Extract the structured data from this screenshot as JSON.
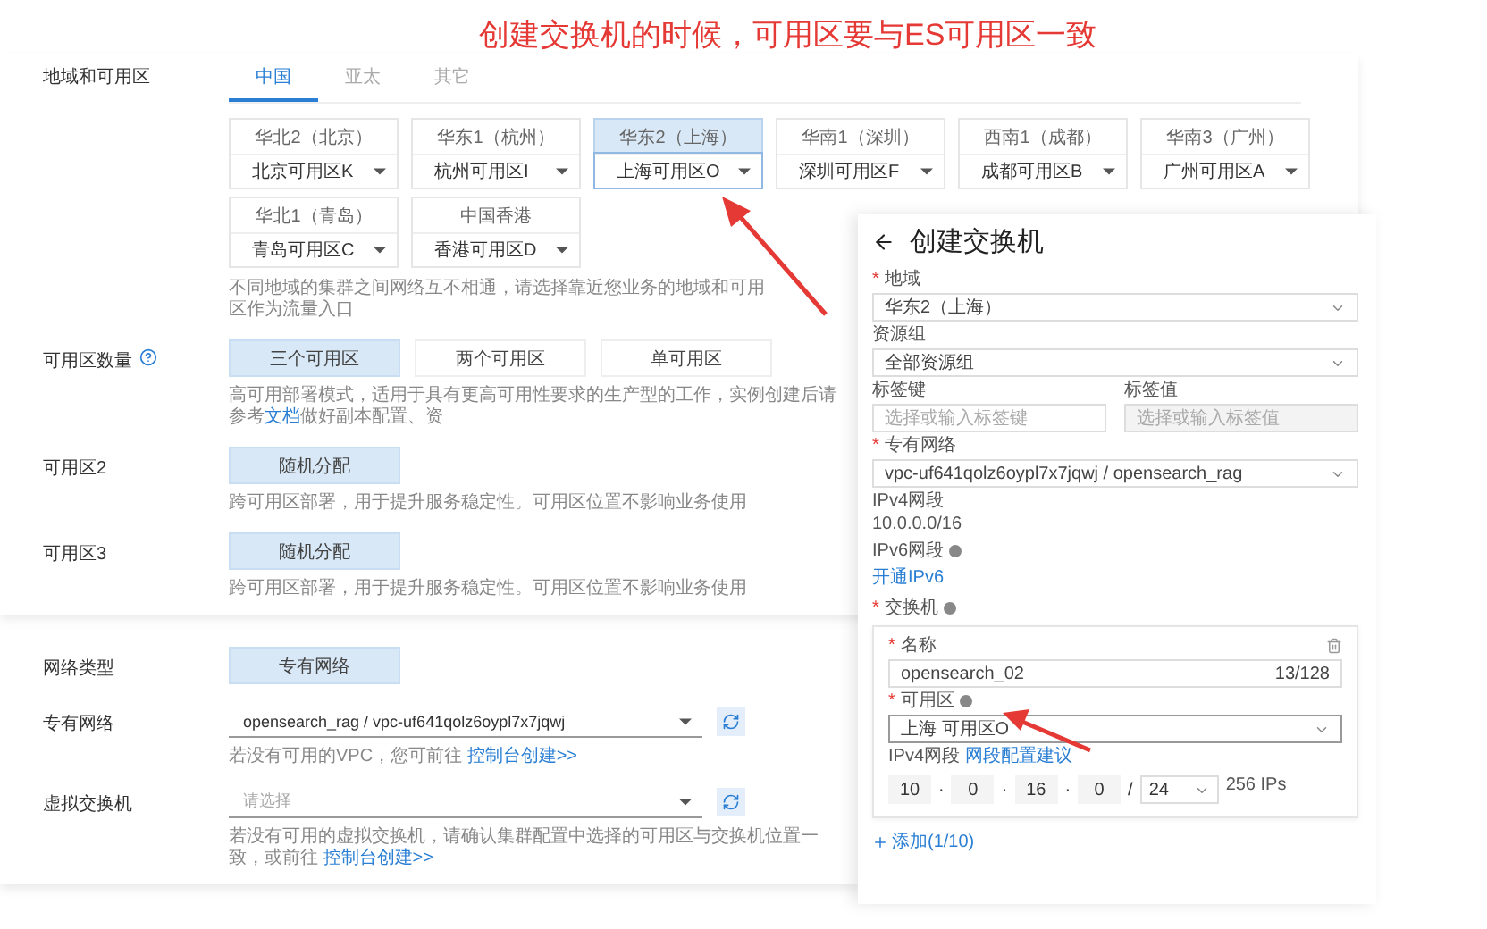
{
  "annotation": "创建交换机的时候，可用区要与ES可用区一致",
  "cluster": {
    "region_label": "地域和可用区",
    "tabs": [
      {
        "label": "中国",
        "selected": true
      },
      {
        "label": "亚太",
        "selected": false
      },
      {
        "label": "其它",
        "selected": false
      }
    ],
    "regions": [
      {
        "name": "华北2（北京）",
        "zone": "北京可用区K",
        "selected": false
      },
      {
        "name": "华东1（杭州）",
        "zone": "杭州可用区I",
        "selected": false
      },
      {
        "name": "华东2（上海）",
        "zone": "上海可用区O",
        "selected": true
      },
      {
        "name": "华南1（深圳）",
        "zone": "深圳可用区F",
        "selected": false
      },
      {
        "name": "西南1（成都）",
        "zone": "成都可用区B",
        "selected": false
      },
      {
        "name": "华南3（广州）",
        "zone": "广州可用区A",
        "selected": false
      },
      {
        "name": "华北1（青岛）",
        "zone": "青岛可用区C",
        "selected": false
      },
      {
        "name": "中国香港",
        "zone": "香港可用区D",
        "selected": false
      }
    ],
    "region_note": "不同地域的集群之间网络互不相通，请选择靠近您业务的地域和可用区作为流量入口",
    "zone_count": {
      "label": "可用区数量",
      "options": [
        {
          "label": "三个可用区",
          "selected": true
        },
        {
          "label": "两个可用区",
          "selected": false
        },
        {
          "label": "单可用区",
          "selected": false
        }
      ],
      "description": "高可用部署模式，适用于具有更高可用性要求的生产型的工作，实例创建后请参考",
      "link": "文档",
      "description_after": "做好副本配置、资"
    },
    "zones": [
      {
        "label": "可用区2",
        "value": "随机分配",
        "note": "跨可用区部署，用于提升服务稳定性。可用区位置不影响业务使用"
      },
      {
        "label": "可用区3",
        "value": "随机分配",
        "note": "跨可用区部署，用于提升服务稳定性。可用区位置不影响业务使用"
      }
    ]
  },
  "network": {
    "type_label": "网络类型",
    "type_value": "专有网络",
    "vpc": {
      "label": "专有网络",
      "value": "opensearch_rag / vpc-uf641qolz6oypl7x7jqwj",
      "hint": "若没有可用的VPC，您可前往",
      "link": "控制台创建>>"
    },
    "vswitch": {
      "label": "虚拟交换机",
      "placeholder": "请选择",
      "hint": "若没有可用的虚拟交换机，请确认集群配置中选择的可用区与交换机位置一致，或前往",
      "link": "控制台创建>>"
    }
  },
  "create_vswitch": {
    "title": "创建交换机",
    "region": {
      "required_mark": "*",
      "label": "地域",
      "value": "华东2（上海）"
    },
    "resource_group": {
      "label": "资源组",
      "value": "全部资源组"
    },
    "tag_key": {
      "label": "标签键",
      "placeholder": "选择或输入标签键"
    },
    "tag_value": {
      "label": "标签值",
      "placeholder": "选择或输入标签值"
    },
    "vpc": {
      "required_mark": "*",
      "label": "专有网络",
      "value": "vpc-uf641qolz6oypl7x7jqwj / opensearch_rag"
    },
    "ipv4": {
      "label": "IPv4网段",
      "value": "10.0.0.0/16"
    },
    "ipv6": {
      "label": "IPv6网段",
      "link": "开通IPv6"
    },
    "switch": {
      "required_mark": "*",
      "label": "交换机",
      "name_required_mark": "*",
      "name_label": "名称",
      "name_value": "opensearch_02",
      "name_count": "13/128",
      "zone_required_mark": "*",
      "zone_label": "可用区",
      "zone_value": "上海 可用区O",
      "cidr_label": "IPv4网段",
      "cidr_link": "网段配置建议",
      "octets": [
        "10",
        "0",
        "16",
        "0"
      ],
      "separators": [
        "·",
        "·",
        "·"
      ],
      "slash": "/",
      "mask": "24",
      "ips": "256 IPs"
    },
    "add": "添加(1/10)"
  }
}
